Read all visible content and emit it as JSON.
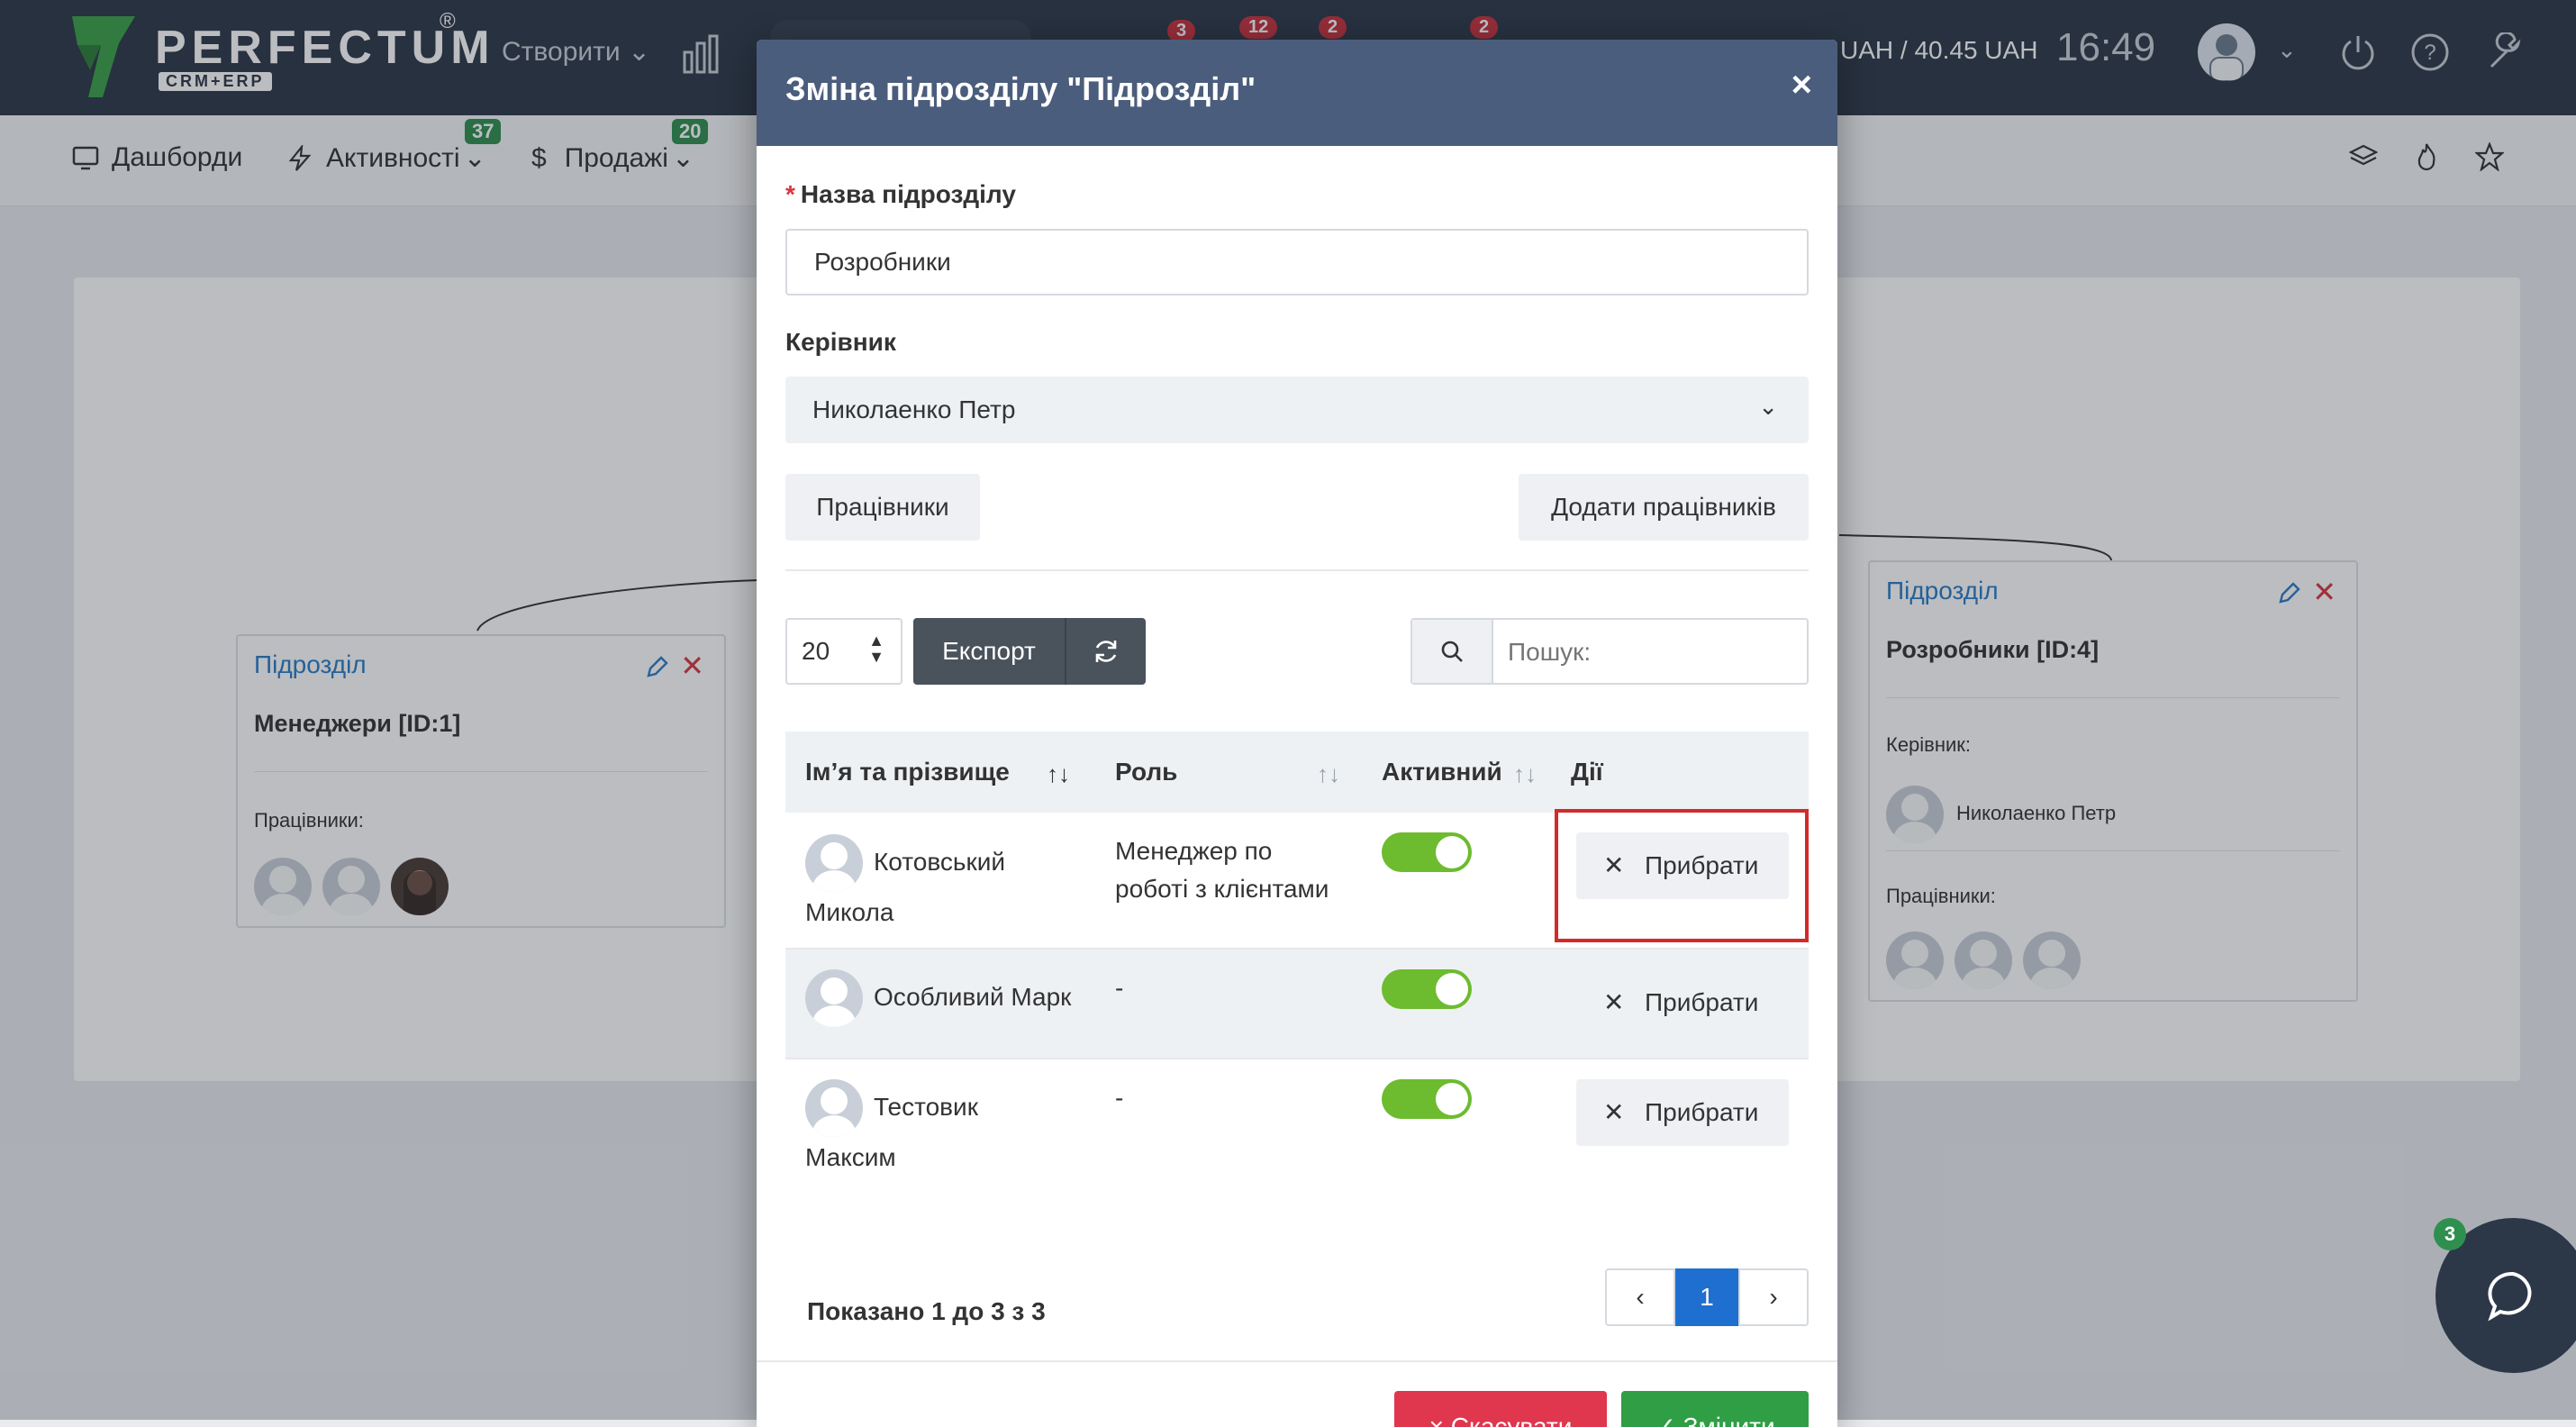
{
  "app": {
    "logo_name": "PERFECTUM",
    "logo_sub": "CRM+ERP",
    "logo_reg": "®",
    "create_label": "Створити",
    "badges": [
      "3",
      "12",
      "2",
      "2"
    ],
    "currency": "UAH / 40.45 UAH",
    "clock": "16:49"
  },
  "subnav": {
    "items": [
      {
        "label": "Дашборди"
      },
      {
        "label": "Активності",
        "badge": "37"
      },
      {
        "label": "Продажі",
        "badge": "20"
      }
    ]
  },
  "org": {
    "left_card": {
      "head": "Підрозділ",
      "name": "Менеджери [ID:1]",
      "employees_label": "Працівники:"
    },
    "right_card": {
      "head": "Підрозділ",
      "name": "Розробники [ID:4]",
      "manager_label": "Керівник:",
      "manager_name": "Николаенко Петр",
      "employees_label": "Працівники:"
    }
  },
  "modal": {
    "title": "Зміна підрозділу \"Підрозділ\"",
    "close": "×",
    "name_label": "Назва підрозділу",
    "required_mark": "*",
    "name_value": "Розробники",
    "manager_label": "Керівник",
    "manager_value": "Николаенко Петр",
    "employees_button": "Працівники",
    "add_employees_button": "Додати працівників",
    "page_length": "20",
    "export_button": "Експорт",
    "search_placeholder": "Пошук:",
    "columns": [
      "Імʼя та прізвище",
      "Роль",
      "Активний",
      "Дії"
    ],
    "rows": [
      {
        "name_line1": "Котовський",
        "name_line2": "Микола",
        "role_line1": "Менеджер по",
        "role_line2": "роботі з клієнтами",
        "action": "Прибрати"
      },
      {
        "name_line1": "Особливий Марк",
        "name_line2": "",
        "role_line1": "-",
        "role_line2": "",
        "action": "Прибрати"
      },
      {
        "name_line1": "Тестовик",
        "name_line2": "Максим",
        "role_line1": "-",
        "role_line2": "",
        "action": "Прибрати"
      }
    ],
    "shown_text": "Показано 1 до 3 з 3",
    "pager": {
      "prev": "‹",
      "current": "1",
      "next": "›"
    },
    "cancel_button": "× Скасувати",
    "save_button": "✓ Змінити"
  },
  "chat": {
    "badge": "3"
  }
}
